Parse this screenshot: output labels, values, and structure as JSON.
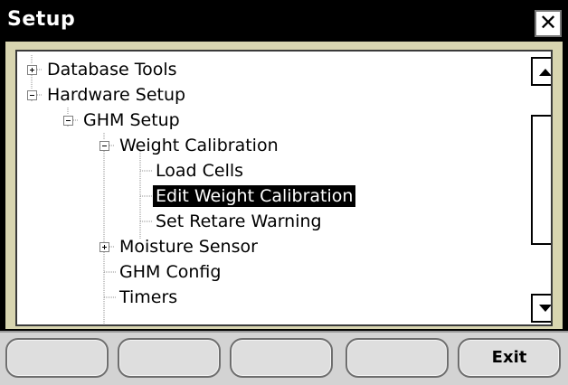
{
  "window": {
    "title": "Setup",
    "close_symbol": "✕"
  },
  "tree": {
    "items": [
      {
        "label": "Database Tools",
        "toggle": "expand"
      },
      {
        "label": "Hardware Setup",
        "toggle": "collapse"
      },
      {
        "label": "GHM Setup",
        "toggle": "collapse"
      },
      {
        "label": "Weight Calibration",
        "toggle": "collapse"
      },
      {
        "label": "Load Cells",
        "toggle": "none"
      },
      {
        "label": "Edit Weight Calibration",
        "toggle": "none",
        "selected": true
      },
      {
        "label": "Set Retare Warning",
        "toggle": "none"
      },
      {
        "label": "Moisture Sensor",
        "toggle": "expand"
      },
      {
        "label": "GHM Config",
        "toggle": "none"
      },
      {
        "label": "Timers",
        "toggle": "none"
      }
    ]
  },
  "scrollbar": {
    "up_icon": "scroll-up-arrow",
    "down_icon": "scroll-down-arrow"
  },
  "footer": {
    "buttons": [
      "",
      "",
      "",
      "",
      "Exit"
    ]
  },
  "colors": {
    "selection_bg": "#000000",
    "panel_bg": "#d8d5b0",
    "footer_bg": "#d3d3d3"
  }
}
